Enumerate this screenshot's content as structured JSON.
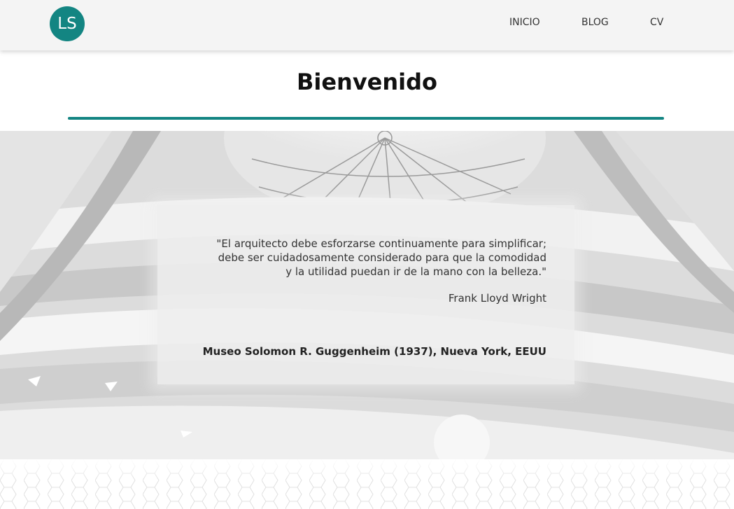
{
  "nav": {
    "logo_text": "LS",
    "links": [
      {
        "label": "INICIO"
      },
      {
        "label": "BLOG"
      },
      {
        "label": "CV"
      }
    ]
  },
  "main": {
    "title": "Bienvenido"
  },
  "hero": {
    "quote_lines": [
      "\"El arquitecto debe esforzarse continuamente para simplificar;",
      "debe ser cuidadosamente considerado para que la comodidad",
      "y la utilidad puedan ir de la mano con la belleza.\""
    ],
    "author": "Frank Lloyd Wright",
    "caption": "Museo Solomon R. Guggenheim (1937), Nueva York, EEUU"
  },
  "colors": {
    "accent": "#138582",
    "navbar_bg": "#f4f4f4"
  }
}
